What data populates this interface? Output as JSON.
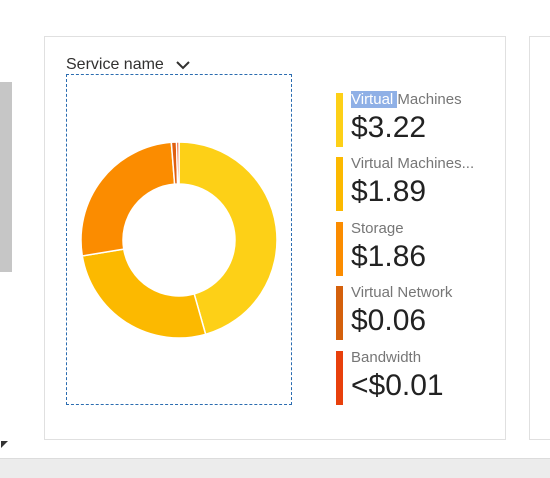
{
  "dropdown": {
    "label": "Service name",
    "icon": "chevron-down-icon"
  },
  "colors": {
    "focus_border": "#2b6cb0",
    "selection_highlight": "#8fb0e6"
  },
  "chart_data": {
    "type": "pie",
    "donut": true,
    "currency": "$",
    "categories": [
      "Virtual Machines",
      "Virtual Machines...",
      "Storage",
      "Virtual Network",
      "Bandwidth"
    ],
    "values": [
      3.22,
      1.89,
      1.86,
      0.06,
      0.004
    ],
    "labels": [
      "$3.22",
      "$1.89",
      "$1.86",
      "$0.06",
      "<$0.01"
    ],
    "colors": [
      "#fdd017",
      "#fcb900",
      "#fb8c00",
      "#e06010",
      "#e8400c"
    ],
    "legend_position": "right"
  },
  "legend": [
    {
      "name_highlight": "Virtual ",
      "name_rest": "Machines",
      "value": "$3.22",
      "color": "#fdd017"
    },
    {
      "name_highlight": "",
      "name_rest": "Virtual Machines...",
      "value": "$1.89",
      "color": "#fcb900"
    },
    {
      "name_highlight": "",
      "name_rest": "Storage",
      "value": "$1.86",
      "color": "#fb8c00"
    },
    {
      "name_highlight": "",
      "name_rest": "Virtual Network",
      "value": "$0.06",
      "color": "#d4600c"
    },
    {
      "name_highlight": "",
      "name_rest": "Bandwidth",
      "value": "<$0.01",
      "color": "#e8400c"
    }
  ]
}
